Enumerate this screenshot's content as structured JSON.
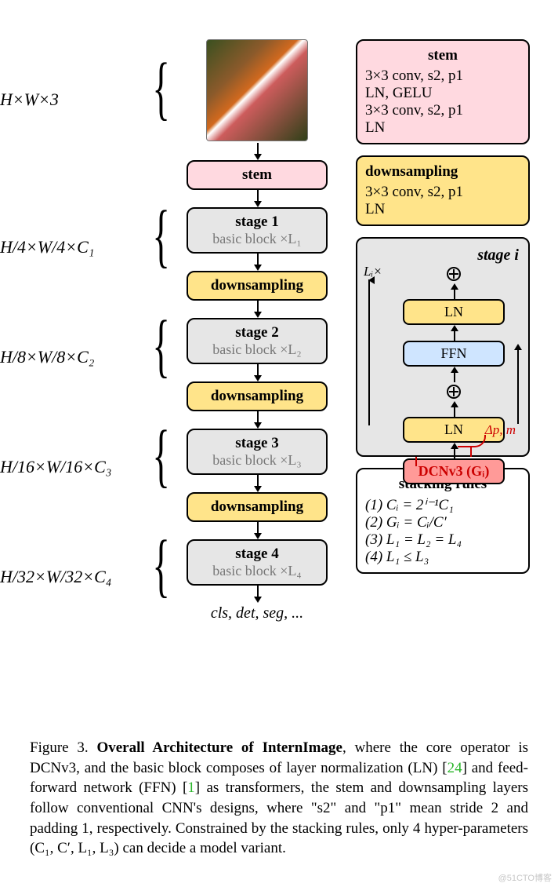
{
  "dims": {
    "input": "H×W×3",
    "s1": "H/4×W/4×C₁",
    "s2": "H/8×W/8×C₂",
    "s3": "H/16×W/16×C₃",
    "s4": "H/32×W/32×C₄"
  },
  "flow": {
    "stem": "stem",
    "stage1_title": "stage 1",
    "stage1_sub": "basic block ×L₁",
    "ds": "downsampling",
    "stage2_title": "stage 2",
    "stage2_sub": "basic block ×L₂",
    "stage3_title": "stage 3",
    "stage3_sub": "basic block ×L₃",
    "stage4_title": "stage 4",
    "stage4_sub": "basic block ×L₄",
    "outputs": "cls, det, seg, ..."
  },
  "stem_box": {
    "title": "stem",
    "l1": "3×3 conv, s2, p1",
    "l2": "LN, GELU",
    "l3": "3×3 conv, s2, p1",
    "l4": "LN"
  },
  "ds_box": {
    "title": "downsampling",
    "l1": "3×3 conv, s2, p1",
    "l2": "LN"
  },
  "stage_detail": {
    "title": "stage i",
    "repeat": "Lᵢ×",
    "ln": "LN",
    "ffn": "FFN",
    "dcn": "DCNv3 (Gᵢ)",
    "delta": "Δp, m"
  },
  "rules": {
    "title": "stacking rules",
    "r1": "(1) Cᵢ = 2ⁱ⁻¹C₁",
    "r2": "(2) Gᵢ = Cᵢ/C′",
    "r3": "(3) L₁ = L₂ = L₄",
    "r4": "(4) L₁ ≤ L₃"
  },
  "caption": {
    "fig": "Figure 3.",
    "bold": " Overall Architecture of InternImage",
    "body1": ", where the core operator is DCNv3, and the basic block composes of layer normalization (LN) [",
    "ref1": "24",
    "body2": "] and feed-forward network (FFN) [",
    "ref2": "1",
    "body3": "] as transformers, the stem and downsampling layers follow conventional CNN's designs, where \"s2\" and \"p1\" mean stride 2 and padding 1, respectively. Constrained by the stacking rules, only 4 hyper-parameters (C₁, C′, L₁, L₃) can decide a model variant."
  },
  "watermark": "@51CTO博客"
}
